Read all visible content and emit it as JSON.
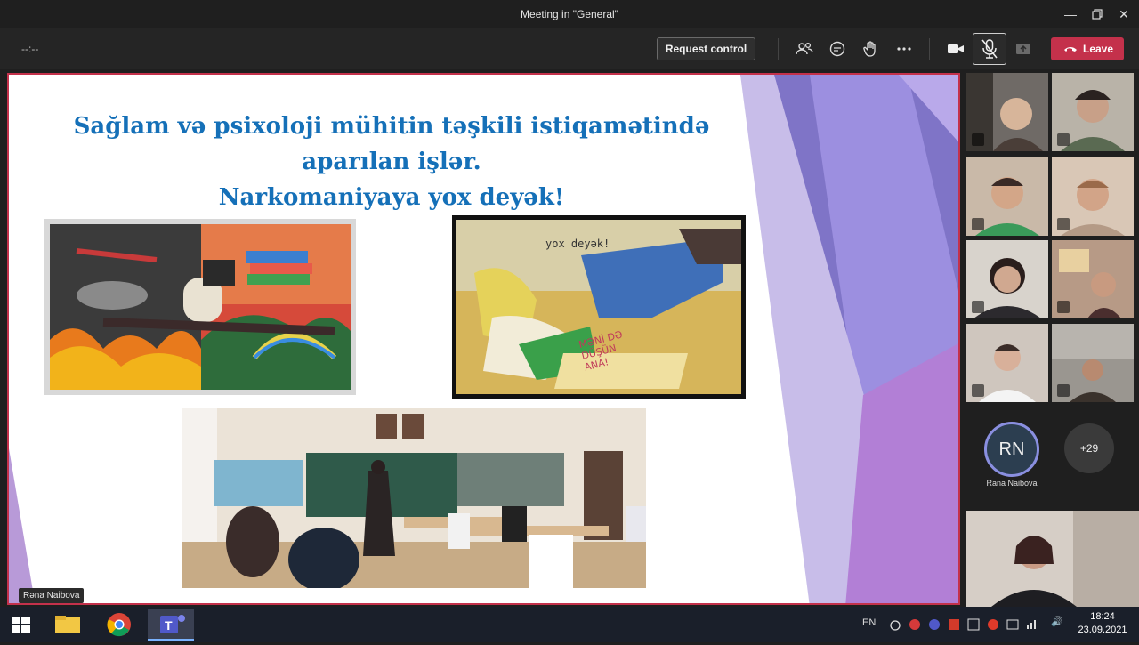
{
  "window": {
    "title": "Meeting in \"General\""
  },
  "toolbar": {
    "timer": "--:--",
    "request_control_label": "Request control",
    "leave_label": "Leave"
  },
  "slide": {
    "title_lines": [
      "Sağlam və psixoloji mühitin təşkili istiqamətində",
      "aparılan işlər.",
      "Narkomaniyaya yox deyək!"
    ],
    "drawing2_text": {
      "top": "yox deyək!",
      "line1": "MƏNİ DƏ",
      "line2": "DÜŞÜN",
      "line3": "ANA!"
    },
    "presenter_label": "Rəna Naibova"
  },
  "participants": {
    "avatar_initials": "RN",
    "avatar_name": "Rana Naibova",
    "more_count": "+29"
  },
  "taskbar": {
    "language": "EN",
    "time": "18:24",
    "date": "23.09.2021"
  },
  "colors": {
    "accent": "#c4314b",
    "title_blue": "#1570b8",
    "avatar_ring": "#8a8fe0"
  }
}
